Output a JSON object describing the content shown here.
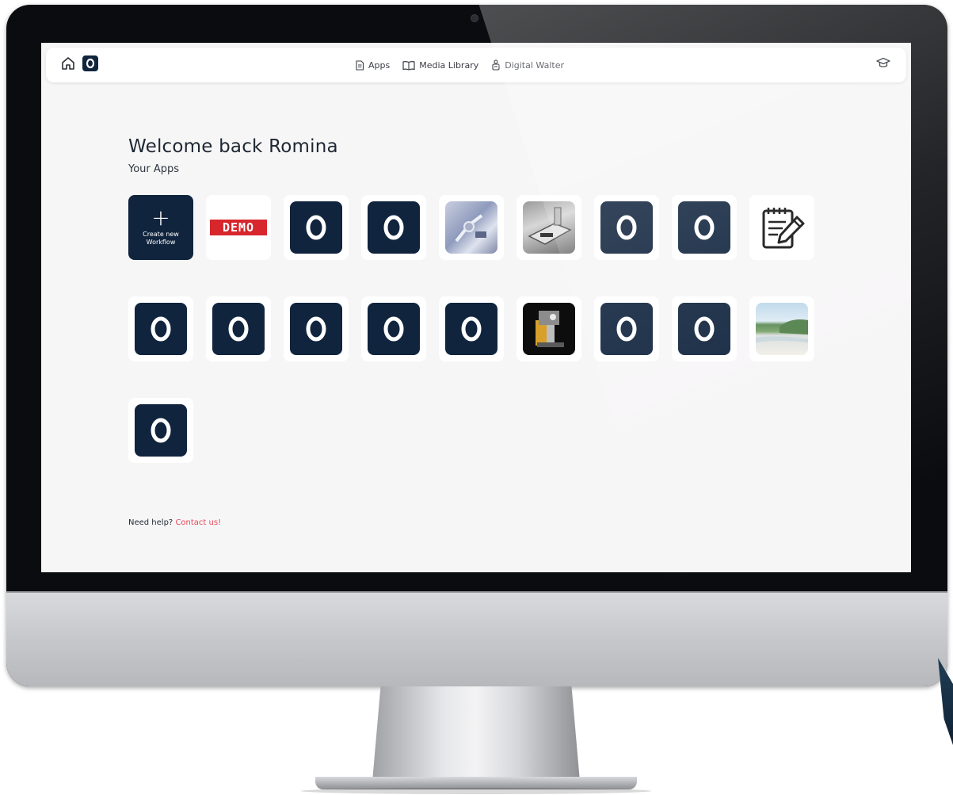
{
  "nav": {
    "items": [
      {
        "label": "Apps",
        "icon": "document-icon"
      },
      {
        "label": "Media Library",
        "icon": "book-icon"
      },
      {
        "label": "Digital Walter",
        "icon": "robot-icon"
      }
    ]
  },
  "main": {
    "welcome": "Welcome back Romina",
    "section_title": "Your Apps",
    "create_tile": {
      "plus": "+",
      "label_line1": "Create new",
      "label_line2": "Workflow"
    },
    "demo_label": "DEMO"
  },
  "footer": {
    "help_text": "Need help?",
    "contact_link": "Contact us!"
  },
  "colors": {
    "brand_navy": "#10243e",
    "link_pink": "#e8485a",
    "demo_red": "#d7262c"
  }
}
